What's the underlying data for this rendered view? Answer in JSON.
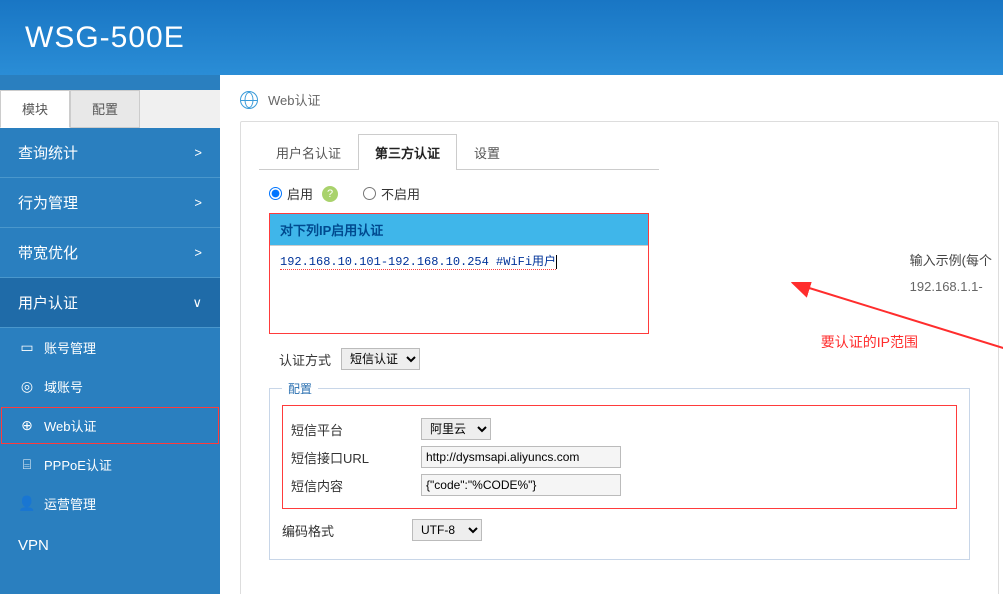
{
  "header": {
    "title": "WSG-500E"
  },
  "sidebar": {
    "tabs": {
      "module": "模块",
      "config": "配置"
    },
    "nav": {
      "stats": "查询统计",
      "behavior": "行为管理",
      "bandwidth": "带宽优化",
      "auth": "用户认证",
      "vpn": "VPN"
    },
    "sub": {
      "account": "账号管理",
      "domain": "域账号",
      "web": "Web认证",
      "pppoe": "PPPoE认证",
      "op": "运营管理"
    }
  },
  "page": {
    "title": "Web认证"
  },
  "tabs": {
    "user": "用户名认证",
    "third": "第三方认证",
    "settings": "设置"
  },
  "enable": {
    "on": "启用",
    "off": "不启用"
  },
  "ipblock": {
    "title": "对下列IP启用认证",
    "line": "192.168.10.101-192.168.10.254  #WiFi用户"
  },
  "authmode": {
    "label": "认证方式",
    "value": "短信认证"
  },
  "config": {
    "legend": "配置",
    "platform_label": "短信平台",
    "platform_value": "阿里云",
    "url_label": "短信接口URL",
    "url_value": "http://dysmsapi.aliyuncs.com",
    "content_label": "短信内容",
    "content_value": "{\"code\":\"%CODE%\"}",
    "encoding_label": "编码格式",
    "encoding_value": "UTF-8"
  },
  "example": {
    "title": "输入示例(每个",
    "line": "192.168.1.1-"
  },
  "annotation": "要认证的IP范围"
}
